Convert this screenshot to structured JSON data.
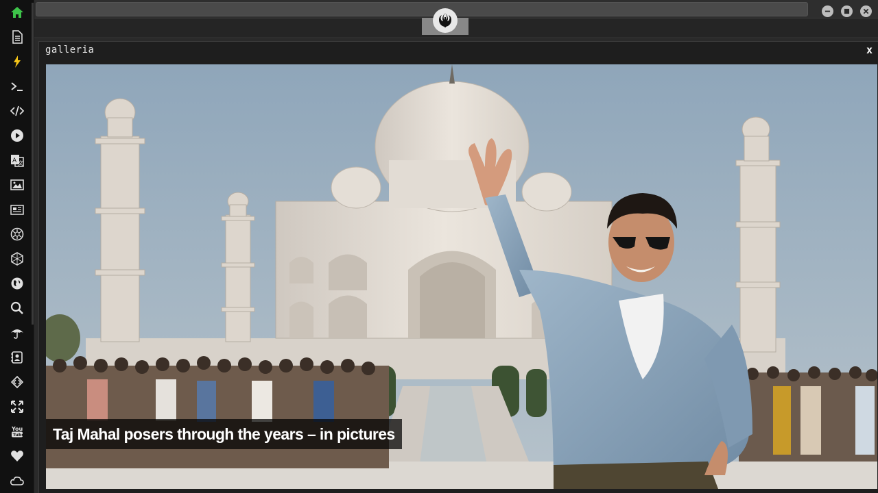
{
  "sidebar": {
    "items": [
      {
        "icon": "home-icon",
        "active": true
      },
      {
        "icon": "document-icon"
      },
      {
        "icon": "lightning-icon"
      },
      {
        "icon": "terminal-icon"
      },
      {
        "icon": "code-icon"
      },
      {
        "icon": "play-icon"
      },
      {
        "icon": "translate-icon"
      },
      {
        "icon": "image-icon"
      },
      {
        "icon": "newspaper-icon"
      },
      {
        "icon": "aperture-icon"
      },
      {
        "icon": "hexagon-icon"
      },
      {
        "icon": "globe-icon"
      },
      {
        "icon": "search-icon"
      },
      {
        "icon": "umbrella-icon"
      },
      {
        "icon": "contact-icon"
      },
      {
        "icon": "code-diamond-icon"
      },
      {
        "icon": "expand-icon"
      },
      {
        "icon": "youtube-icon"
      },
      {
        "icon": "heart-icon"
      },
      {
        "icon": "cloud-icon"
      }
    ],
    "active_color": "#3ec44a",
    "lightning_color": "#f5c518"
  },
  "window": {
    "title": "galleria",
    "close_label": "x"
  },
  "gallery": {
    "caption": "Taj Mahal posers through the years – in pictures",
    "image_icon": "photo-taj-mahal"
  }
}
